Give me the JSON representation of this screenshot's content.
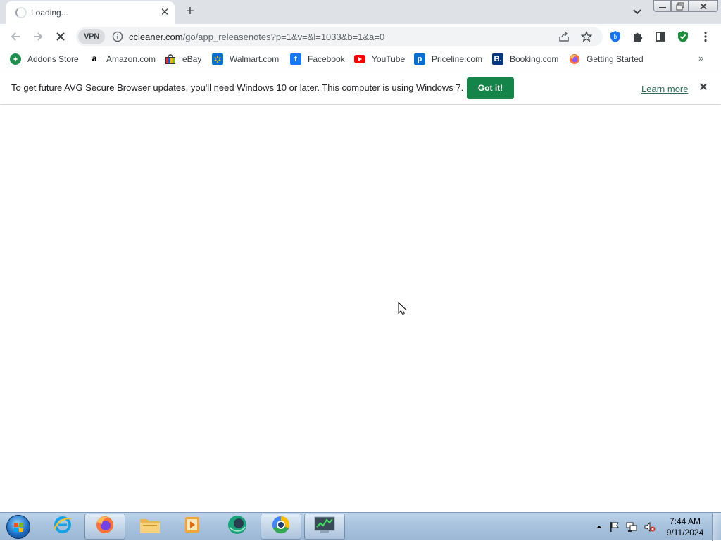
{
  "tab": {
    "title": "Loading...",
    "close_glyph": "✕",
    "new_tab_glyph": "+"
  },
  "window": {
    "minimize_icon": "minimize-icon",
    "restore_icon": "restore-icon",
    "close_icon": "close-icon"
  },
  "toolbar": {
    "vpn_label": "VPN",
    "url_host": "ccleaner.com",
    "url_path": "/go/app_releasenotes?p=1&v=&l=1033&b=1&a=0"
  },
  "bookmarks": [
    {
      "label": "Addons Store",
      "icon": "addons-store-icon",
      "color": "#1e8e4e"
    },
    {
      "label": "Amazon.com",
      "icon": "amazon-icon",
      "color": "#ffffff"
    },
    {
      "label": "eBay",
      "icon": "ebay-icon",
      "color": "#ffffff"
    },
    {
      "label": "Walmart.com",
      "icon": "walmart-icon",
      "color": "#0071ce"
    },
    {
      "label": "Facebook",
      "icon": "facebook-icon",
      "color": "#1877f2"
    },
    {
      "label": "YouTube",
      "icon": "youtube-icon",
      "color": "#ff0000"
    },
    {
      "label": "Priceline.com",
      "icon": "priceline-icon",
      "color": "#0a6ed1"
    },
    {
      "label": "Booking.com",
      "icon": "booking-icon",
      "color": "#003580"
    },
    {
      "label": "Getting Started",
      "icon": "firefox-icon",
      "color": "#ff7139"
    }
  ],
  "bookmarks_more": "»",
  "infobar": {
    "message": "To get future AVG Secure Browser updates, you'll need Windows 10 or later. This computer is using Windows 7.",
    "button_label": "Got it!",
    "learn_more": "Learn more",
    "close_glyph": "✕"
  },
  "taskbar": {
    "items": [
      "internet-explorer-icon",
      "firefox-icon",
      "file-explorer-icon",
      "media-player-icon",
      "green-browser-icon",
      "avg-browser-icon",
      "task-manager-icon"
    ],
    "time": "7:44 AM",
    "date": "9/11/2024"
  },
  "colors": {
    "accent_green": "#148448",
    "tabstrip": "#dee1e6",
    "omnibox": "#f1f3f4"
  }
}
